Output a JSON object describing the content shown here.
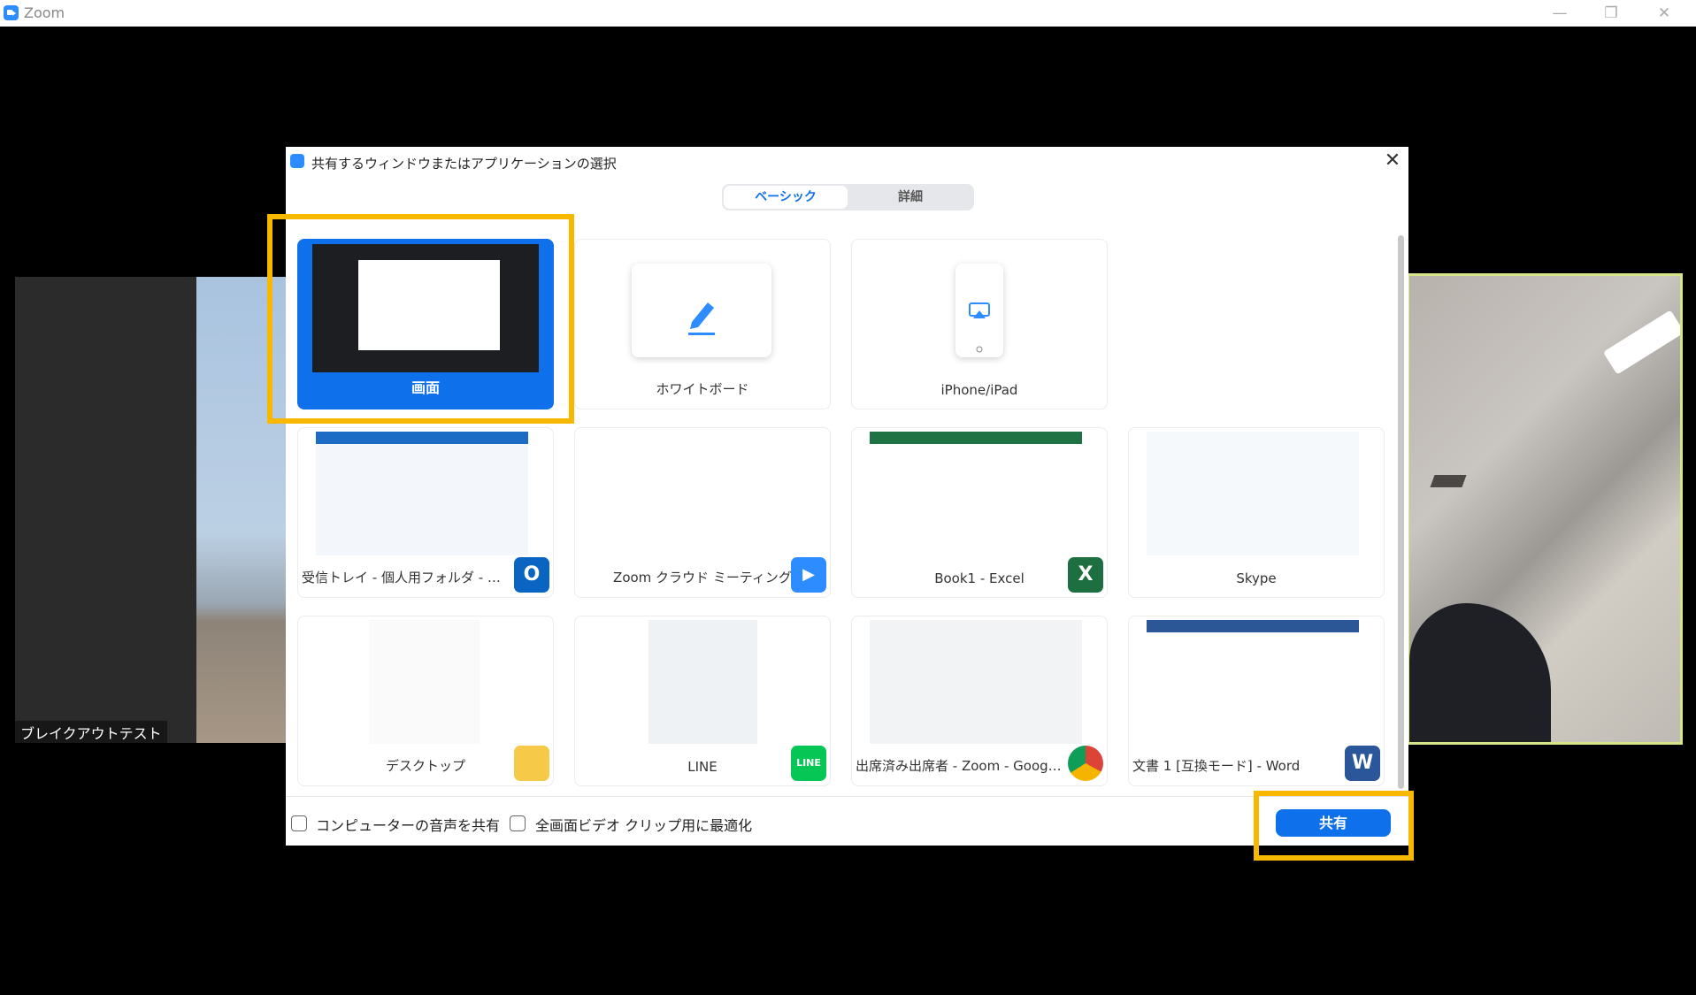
{
  "window": {
    "title": "Zoom"
  },
  "participants": {
    "left_name": "ブレイクアウトテスト"
  },
  "dialog": {
    "title": "共有するウィンドウまたはアプリケーションの選択",
    "tabs": [
      "ベーシック",
      "詳細"
    ],
    "tiles": [
      {
        "label": "画面",
        "icon": "monitor-screen"
      },
      {
        "label": "ホワイトボード",
        "icon": "pencil-icon"
      },
      {
        "label": "iPhone/iPad",
        "icon": "airplay-icon"
      },
      {
        "label": "受信トレイ - 個人用フォルダ - Outl...",
        "icon": "outlook-icon"
      },
      {
        "label": "Zoom クラウド ミーティング",
        "icon": "zoom-icon"
      },
      {
        "label": "Book1 - Excel",
        "icon": "excel-icon"
      },
      {
        "label": "Skype",
        "icon": ""
      },
      {
        "label": "デスクトップ",
        "icon": "desktop-folder-icon"
      },
      {
        "label": "LINE",
        "icon": "line-icon"
      },
      {
        "label": "出席済み出席者 - Zoom - Googl...",
        "icon": "chrome-icon"
      },
      {
        "label": "文書 1 [互換モード] - Word",
        "icon": "word-icon"
      }
    ],
    "footer": {
      "share_audio_label": "コンピューターの音声を共有",
      "optimize_video_label": "全画面ビデオ クリップ用に最適化",
      "share_button": "共有"
    }
  },
  "colors": {
    "accent": "#0e71eb",
    "highlight": "#f8b800"
  }
}
